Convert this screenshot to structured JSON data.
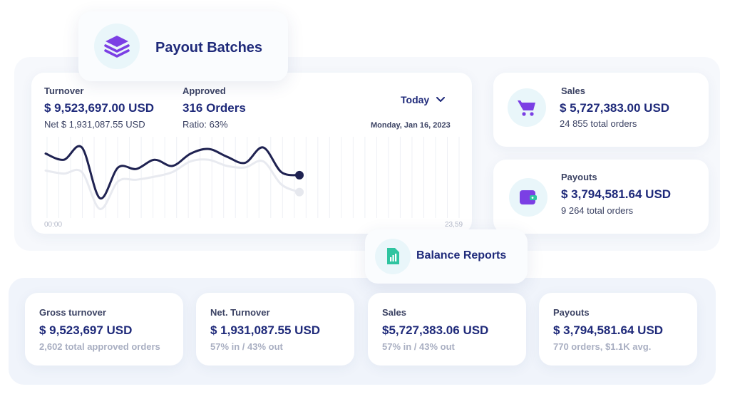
{
  "header_tags": {
    "payout_batches": "Payout Batches",
    "balance_reports": "Balance Reports"
  },
  "turnover_card": {
    "turnover_label": "Turnover",
    "turnover_value": "$ 9,523,697.00 USD",
    "net_value": "Net $ 1,931,087.55 USD",
    "approved_label": "Approved",
    "approved_value": "316 Orders",
    "ratio": "Ratio: 63%",
    "period_select": "Today",
    "date": "Monday, Jan 16, 2023",
    "axis_start": "00:00",
    "axis_end": "23,59"
  },
  "sales_card": {
    "label": "Sales",
    "value": "$ 5,727,383.00 USD",
    "orders": "24 855 total orders"
  },
  "payouts_card": {
    "label": "Payouts",
    "value": "$ 3,794,581.64 USD",
    "orders": "9 264 total orders"
  },
  "stats": [
    {
      "label": "Gross turnover",
      "value": "$ 9,523,697 USD",
      "sub": "2,602 total approved orders"
    },
    {
      "label": "Net. Turnover",
      "value": "$ 1,931,087.55 USD",
      "sub": "57% in / 43% out"
    },
    {
      "label": "Sales",
      "value": "$5,727,383.06 USD",
      "sub": "57% in / 43% out"
    },
    {
      "label": "Payouts",
      "value": "$ 3,794,581.64 USD",
      "sub": "770 orders, $1.1K avg."
    }
  ],
  "colors": {
    "primary": "#1f2a7a",
    "purple": "#7b3fe4",
    "green": "#2ec4a0",
    "icon_bg": "#e9f6fa"
  },
  "chart_data": {
    "type": "line",
    "series": [
      {
        "values": [
          0.8,
          0.72,
          0.88,
          0.22,
          0.62,
          0.6,
          0.72,
          0.64,
          0.8,
          0.86,
          0.76,
          0.68,
          0.88,
          0.56,
          0.52
        ]
      },
      {
        "values": [
          0.58,
          0.54,
          0.56,
          0.08,
          0.44,
          0.46,
          0.5,
          0.56,
          0.7,
          0.72,
          0.64,
          0.62,
          0.7,
          0.4,
          0.3
        ]
      }
    ],
    "ylim": [
      0,
      1
    ],
    "x_start_label": "00:00",
    "x_end_label": "23,59",
    "grid": "vertical"
  }
}
